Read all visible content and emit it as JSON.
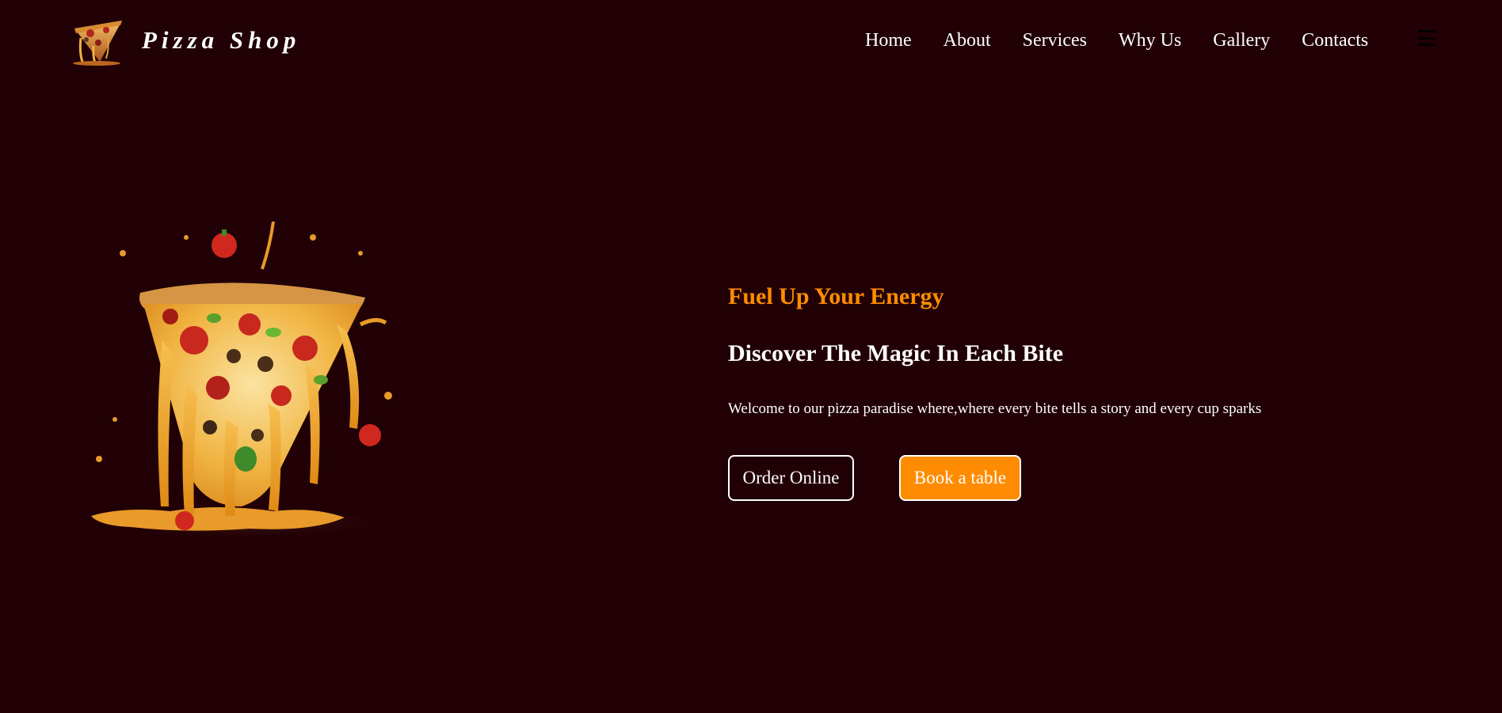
{
  "header": {
    "brand": "Pizza Shop",
    "logo_icon": "pizza-slice-logo",
    "nav": [
      "Home",
      "About",
      "Services",
      "Why Us",
      "Gallery",
      "Contacts"
    ],
    "menu_icon": "hamburger-menu-icon"
  },
  "hero": {
    "tagline": "Fuel Up Your Energy",
    "headline": "Discover The Magic In Each Bite",
    "intro": "Welcome to our pizza paradise where,where every bite tells a story and every cup sparks",
    "order_label": "Order Online",
    "book_label": "Book a table",
    "image_icon": "melting-pizza-slice-image"
  },
  "colors": {
    "background": "#210006",
    "accent": "#ff8c00",
    "text": "#ffffff"
  }
}
